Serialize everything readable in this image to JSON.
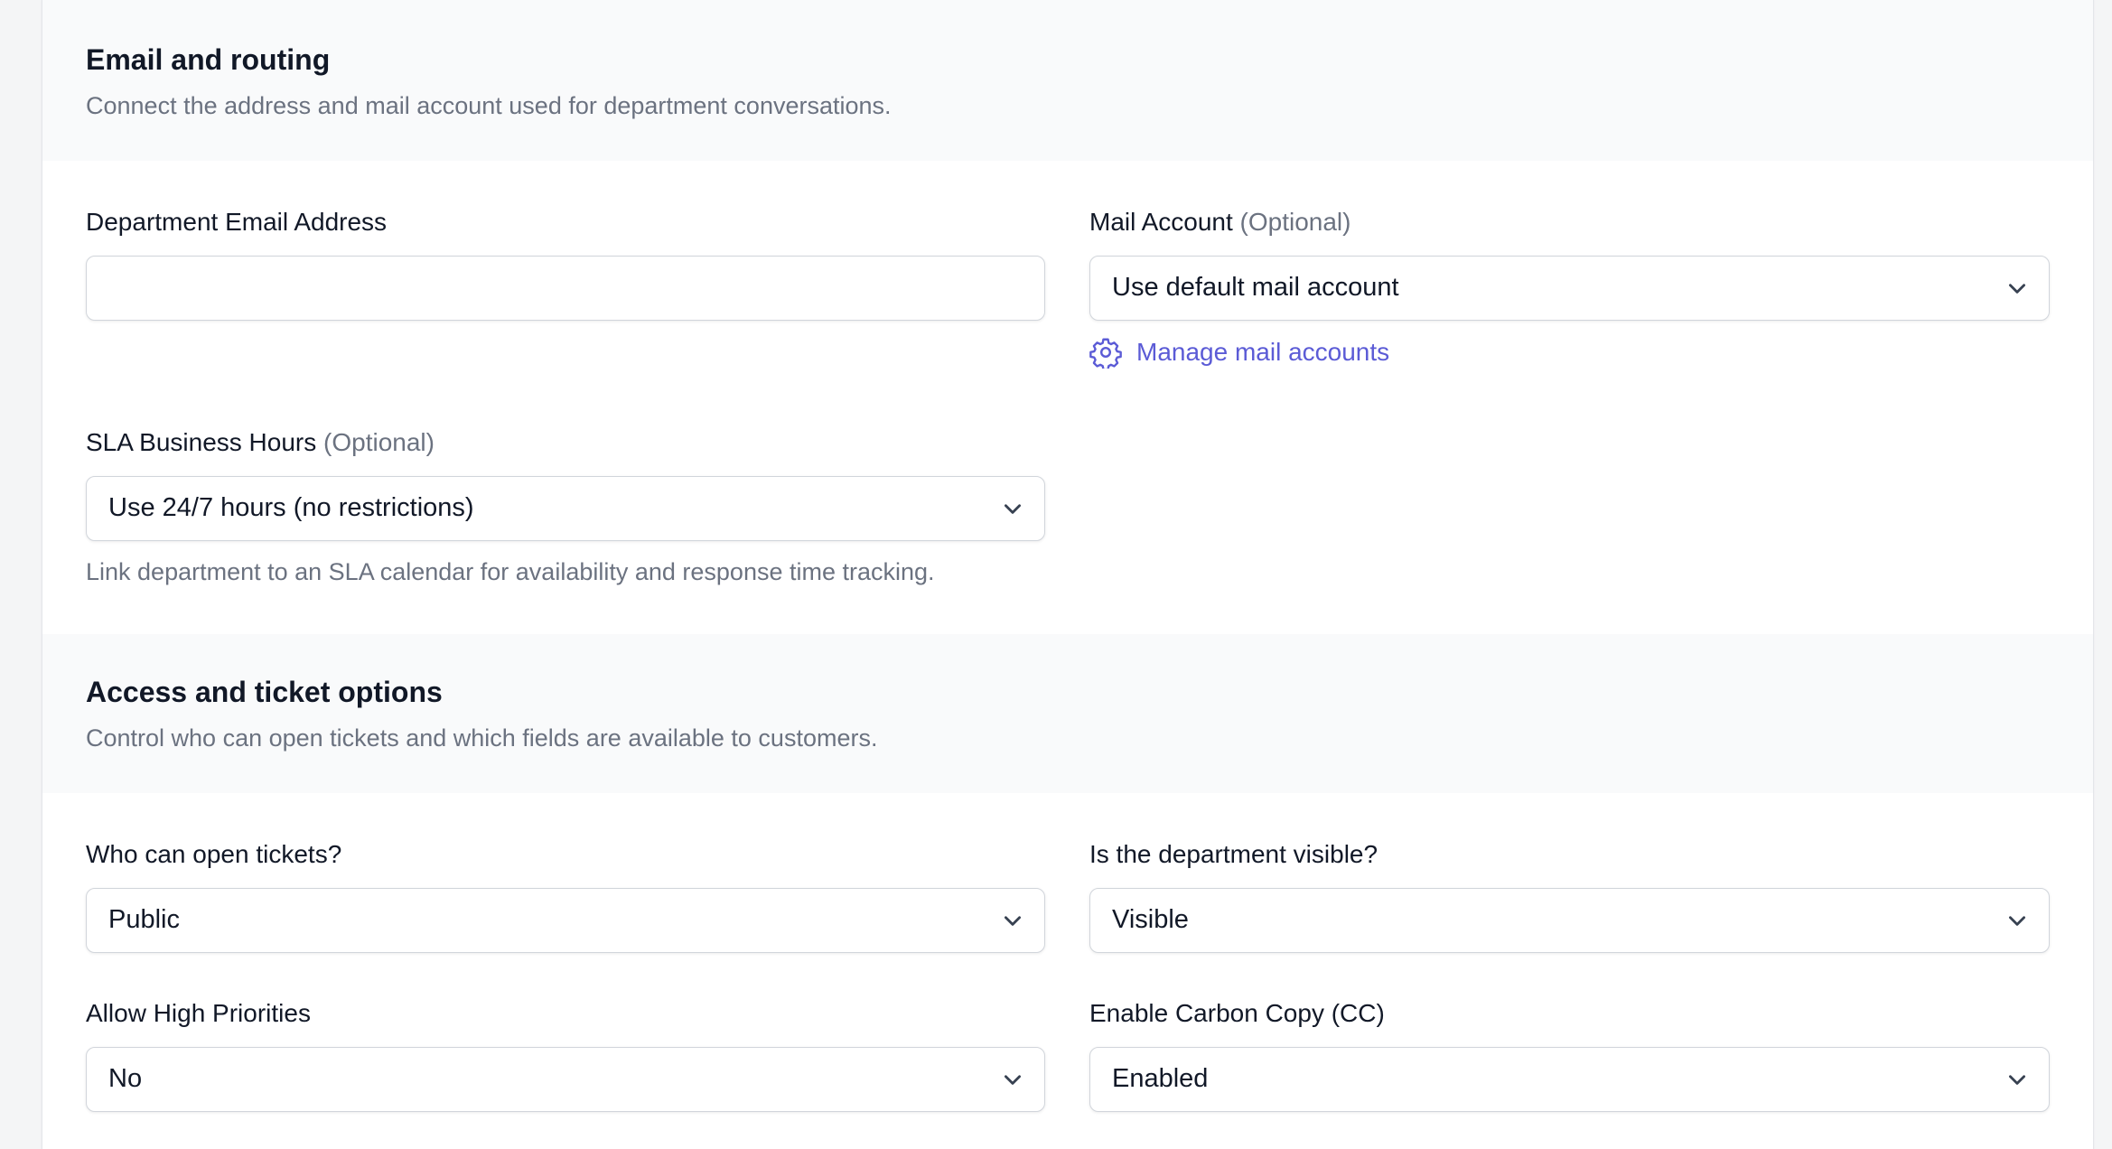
{
  "sections": [
    {
      "title": "Email and routing",
      "description": "Connect the address and mail account used for department conversations."
    },
    {
      "title": "Access and ticket options",
      "description": "Control who can open tickets and which fields are available to customers."
    }
  ],
  "email_routing": {
    "department_email": {
      "label": "Department Email Address",
      "value": ""
    },
    "mail_account": {
      "label": "Mail Account",
      "optional": "(Optional)",
      "value": "Use default mail account",
      "manage_link": "Manage mail accounts",
      "manage_icon": "gear-icon"
    },
    "sla_hours": {
      "label": "SLA Business Hours",
      "optional": "(Optional)",
      "value": "Use 24/7 hours (no restrictions)",
      "help": "Link department to an SLA calendar for availability and response time tracking."
    }
  },
  "access": {
    "who_can_open": {
      "label": "Who can open tickets?",
      "value": "Public"
    },
    "visible": {
      "label": "Is the department visible?",
      "value": "Visible"
    },
    "high_priorities": {
      "label": "Allow High Priorities",
      "value": "No"
    },
    "carbon_copy": {
      "label": "Enable Carbon Copy (CC)",
      "value": "Enabled"
    }
  },
  "colors": {
    "link": "#5b5bd6",
    "section_bg": "#f9fafb",
    "muted_text": "#6b7280"
  }
}
